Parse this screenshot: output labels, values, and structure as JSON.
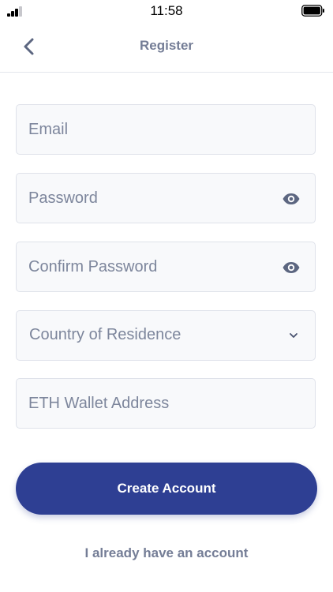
{
  "status_bar": {
    "time": "11:58"
  },
  "header": {
    "title": "Register",
    "back_icon": "chevron-left-icon"
  },
  "form": {
    "email": {
      "placeholder": "Email",
      "value": ""
    },
    "password": {
      "placeholder": "Password",
      "value": "",
      "icon": "eye-icon"
    },
    "confirm_password": {
      "placeholder": "Confirm Password",
      "value": "",
      "icon": "eye-icon"
    },
    "country": {
      "selected": "Country of Residence",
      "icon": "chevron-down-icon"
    },
    "eth_wallet": {
      "placeholder": "ETH Wallet Address",
      "value": ""
    }
  },
  "actions": {
    "create_account_label": "Create Account",
    "login_link_label": "I already have an account"
  },
  "colors": {
    "primary": "#2e3f93",
    "muted_text": "#747d96",
    "field_border": "#dfe2ea",
    "field_bg": "#f8f9fb"
  }
}
